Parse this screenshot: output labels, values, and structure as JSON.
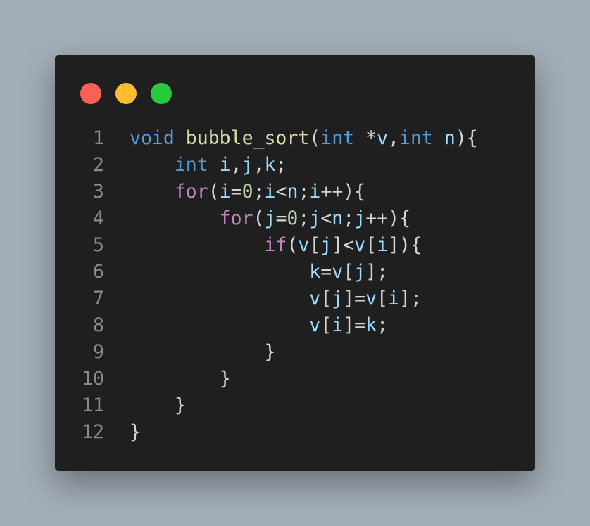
{
  "window": {
    "dots": [
      {
        "name": "close",
        "color": "#ff5f56"
      },
      {
        "name": "minimize",
        "color": "#ffbd2e"
      },
      {
        "name": "maximize",
        "color": "#27c93f"
      }
    ]
  },
  "colors": {
    "background": "#a3adb7",
    "editor": "#1f1f1f",
    "line_number": "#8a8a8a",
    "keyword": "#569cd6",
    "control": "#c586c0",
    "function": "#dcdcaa",
    "variable": "#9cdcfe",
    "number": "#b5cea8",
    "punctuation": "#d4d4d4"
  },
  "code": {
    "lines": [
      {
        "number": "1",
        "tokens": [
          {
            "t": "void",
            "k": "kw"
          },
          {
            "t": " ",
            "k": "ws"
          },
          {
            "t": "bubble_sort",
            "k": "fn"
          },
          {
            "t": "(",
            "k": "punc"
          },
          {
            "t": "int",
            "k": "kw"
          },
          {
            "t": " *",
            "k": "punc"
          },
          {
            "t": "v",
            "k": "var"
          },
          {
            "t": ",",
            "k": "punc"
          },
          {
            "t": "int",
            "k": "kw"
          },
          {
            "t": " ",
            "k": "ws"
          },
          {
            "t": "n",
            "k": "var"
          },
          {
            "t": "){",
            "k": "punc"
          }
        ]
      },
      {
        "number": "2",
        "tokens": [
          {
            "t": "    ",
            "k": "ws"
          },
          {
            "t": "int",
            "k": "kw"
          },
          {
            "t": " ",
            "k": "ws"
          },
          {
            "t": "i",
            "k": "var"
          },
          {
            "t": ",",
            "k": "punc"
          },
          {
            "t": "j",
            "k": "var"
          },
          {
            "t": ",",
            "k": "punc"
          },
          {
            "t": "k",
            "k": "var"
          },
          {
            "t": ";",
            "k": "punc"
          }
        ]
      },
      {
        "number": "3",
        "tokens": [
          {
            "t": "    ",
            "k": "ws"
          },
          {
            "t": "for",
            "k": "ctrl"
          },
          {
            "t": "(",
            "k": "punc"
          },
          {
            "t": "i",
            "k": "var"
          },
          {
            "t": "=",
            "k": "punc"
          },
          {
            "t": "0",
            "k": "num"
          },
          {
            "t": ";",
            "k": "punc"
          },
          {
            "t": "i",
            "k": "var"
          },
          {
            "t": "<",
            "k": "punc"
          },
          {
            "t": "n",
            "k": "var"
          },
          {
            "t": ";",
            "k": "punc"
          },
          {
            "t": "i",
            "k": "var"
          },
          {
            "t": "++){",
            "k": "punc"
          }
        ]
      },
      {
        "number": "4",
        "tokens": [
          {
            "t": "        ",
            "k": "ws"
          },
          {
            "t": "for",
            "k": "ctrl"
          },
          {
            "t": "(",
            "k": "punc"
          },
          {
            "t": "j",
            "k": "var"
          },
          {
            "t": "=",
            "k": "punc"
          },
          {
            "t": "0",
            "k": "num"
          },
          {
            "t": ";",
            "k": "punc"
          },
          {
            "t": "j",
            "k": "var"
          },
          {
            "t": "<",
            "k": "punc"
          },
          {
            "t": "n",
            "k": "var"
          },
          {
            "t": ";",
            "k": "punc"
          },
          {
            "t": "j",
            "k": "var"
          },
          {
            "t": "++){",
            "k": "punc"
          }
        ]
      },
      {
        "number": "5",
        "tokens": [
          {
            "t": "            ",
            "k": "ws"
          },
          {
            "t": "if",
            "k": "ctrl"
          },
          {
            "t": "(",
            "k": "punc"
          },
          {
            "t": "v",
            "k": "var"
          },
          {
            "t": "[",
            "k": "punc"
          },
          {
            "t": "j",
            "k": "var"
          },
          {
            "t": "]<",
            "k": "punc"
          },
          {
            "t": "v",
            "k": "var"
          },
          {
            "t": "[",
            "k": "punc"
          },
          {
            "t": "i",
            "k": "var"
          },
          {
            "t": "]){",
            "k": "punc"
          }
        ]
      },
      {
        "number": "6",
        "tokens": [
          {
            "t": "                ",
            "k": "ws"
          },
          {
            "t": "k",
            "k": "var"
          },
          {
            "t": "=",
            "k": "punc"
          },
          {
            "t": "v",
            "k": "var"
          },
          {
            "t": "[",
            "k": "punc"
          },
          {
            "t": "j",
            "k": "var"
          },
          {
            "t": "];",
            "k": "punc"
          }
        ]
      },
      {
        "number": "7",
        "tokens": [
          {
            "t": "                ",
            "k": "ws"
          },
          {
            "t": "v",
            "k": "var"
          },
          {
            "t": "[",
            "k": "punc"
          },
          {
            "t": "j",
            "k": "var"
          },
          {
            "t": "]=",
            "k": "punc"
          },
          {
            "t": "v",
            "k": "var"
          },
          {
            "t": "[",
            "k": "punc"
          },
          {
            "t": "i",
            "k": "var"
          },
          {
            "t": "];",
            "k": "punc"
          }
        ]
      },
      {
        "number": "8",
        "tokens": [
          {
            "t": "                ",
            "k": "ws"
          },
          {
            "t": "v",
            "k": "var"
          },
          {
            "t": "[",
            "k": "punc"
          },
          {
            "t": "i",
            "k": "var"
          },
          {
            "t": "]=",
            "k": "punc"
          },
          {
            "t": "k",
            "k": "var"
          },
          {
            "t": ";",
            "k": "punc"
          }
        ]
      },
      {
        "number": "9",
        "tokens": [
          {
            "t": "            ",
            "k": "ws"
          },
          {
            "t": "}",
            "k": "punc"
          }
        ]
      },
      {
        "number": "10",
        "tokens": [
          {
            "t": "        ",
            "k": "ws"
          },
          {
            "t": "}",
            "k": "punc"
          }
        ]
      },
      {
        "number": "11",
        "tokens": [
          {
            "t": "    ",
            "k": "ws"
          },
          {
            "t": "}",
            "k": "punc"
          }
        ]
      },
      {
        "number": "12",
        "tokens": [
          {
            "t": "}",
            "k": "punc"
          }
        ]
      }
    ]
  }
}
